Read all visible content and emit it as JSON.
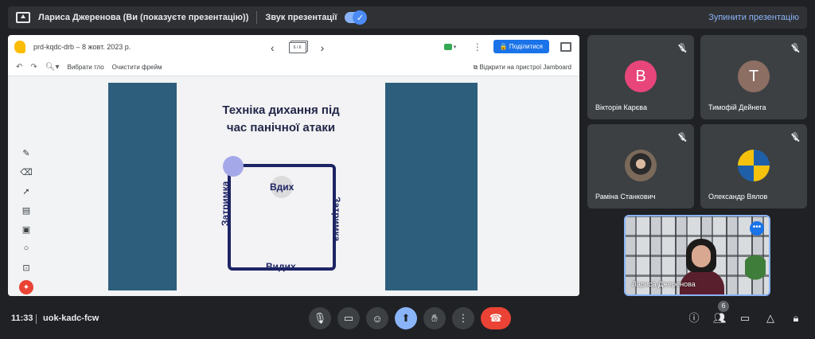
{
  "presenting_bar": {
    "title": "Лариса Джеренова (Ви (показуєте презентацію))",
    "sound_label": "Звук презентації",
    "sound_toggle": "on",
    "stop_label": "Зупинити презентацію"
  },
  "jamboard": {
    "doc_title": "prd-kqdc-drb – 8 жовт. 2023 р.",
    "frame_indicator": "6 / 6",
    "share_label": "Поділитися",
    "toolbar": {
      "set_background": "Вибрати тло",
      "clear_frame": "Очистити фрейм",
      "open_on_device": "Відкрити на пристрої Jamboard"
    },
    "slide": {
      "title_line1": "Техніка дихання під",
      "title_line2": "час панічної атаки",
      "top": "Вдих",
      "right": "Затримка",
      "bottom": "Видих",
      "left": "Затримка"
    }
  },
  "participants": [
    {
      "name": "Вікторія Карєва",
      "initial": "В",
      "color": "#e8467a"
    },
    {
      "name": "Тимофій Дейнега",
      "initial": "Т",
      "color": "#8d6e63"
    },
    {
      "name": "Раміна Станкович",
      "initial": "",
      "color": "#6b5b4f"
    },
    {
      "name": "Олександр Вялов",
      "initial": "",
      "color": "#1f5fa8"
    }
  ],
  "self_view": {
    "name": "Лариса Джеренова"
  },
  "bottom_bar": {
    "time": "11:33",
    "meeting_code": "uok-kadc-fcw",
    "participants_count": "6"
  }
}
